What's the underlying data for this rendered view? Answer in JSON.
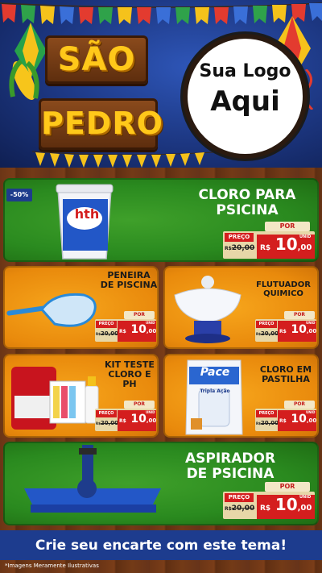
{
  "header": {
    "title_line1": "SÃO",
    "title_line2": "PEDRO",
    "logo_line1": "Sua Logo",
    "logo_line2": "Aqui"
  },
  "colors": {
    "sky_blue": "#1c3680",
    "title_yellow": "#ffc81a",
    "card_green": "#2a8a1f",
    "card_orange": "#e98a0c",
    "price_red": "#d41e1e",
    "footer_blue": "#1d3c8e"
  },
  "discount_badge": "-50%",
  "products": [
    {
      "id": "cloro",
      "title": "CLORO PARA PSICINA",
      "por": "POR",
      "preco": "PREÇO",
      "old_prefix": "R$",
      "old_price": "20,00",
      "currency": "R$",
      "price_int": "10",
      "price_dec": ",00",
      "unit": "UNID",
      "icon": "chlorine-bucket-icon",
      "brand": "hth"
    },
    {
      "id": "peneira",
      "title": "PENEIRA DE PISCINA",
      "por": "POR",
      "preco": "PREÇO",
      "old_prefix": "R$",
      "old_price": "20,00",
      "currency": "R$",
      "price_int": "10",
      "price_dec": ",00",
      "unit": "UNID",
      "icon": "pool-net-icon"
    },
    {
      "id": "flutuador",
      "title": "FLUTUADOR QUIMICO",
      "por": "POR",
      "preco": "PREÇO",
      "old_prefix": "R$",
      "old_price": "20,00",
      "currency": "R$",
      "price_int": "10",
      "price_dec": ",00",
      "unit": "UNID",
      "icon": "chemical-floater-icon"
    },
    {
      "id": "kit",
      "title": "KIT TESTE CLORO E PH",
      "por": "POR",
      "preco": "PREÇO",
      "old_prefix": "R$",
      "old_price": "20,00",
      "currency": "R$",
      "price_int": "10",
      "price_dec": ",00",
      "unit": "UNID",
      "icon": "test-kit-icon"
    },
    {
      "id": "pastilha",
      "title": "CLORO EM PASTILHA",
      "por": "POR",
      "preco": "PREÇO",
      "old_prefix": "R$",
      "old_price": "20,00",
      "currency": "R$",
      "price_int": "10",
      "price_dec": ",00",
      "unit": "UNID",
      "icon": "chlorine-tablet-bag-icon",
      "brand": "Pace",
      "brand_sub": "Tripla Ação"
    },
    {
      "id": "aspirador",
      "title": "ASPIRADOR DE PSICINA",
      "por": "POR",
      "preco": "PREÇO",
      "old_prefix": "R$",
      "old_price": "20,00",
      "currency": "R$",
      "price_int": "10",
      "price_dec": ",00",
      "unit": "UNID",
      "icon": "pool-vacuum-icon"
    }
  ],
  "footer": {
    "cta": "Crie seu encarte com este tema!",
    "disclaimer": "*Imagens Meramente Ilustrativas"
  }
}
